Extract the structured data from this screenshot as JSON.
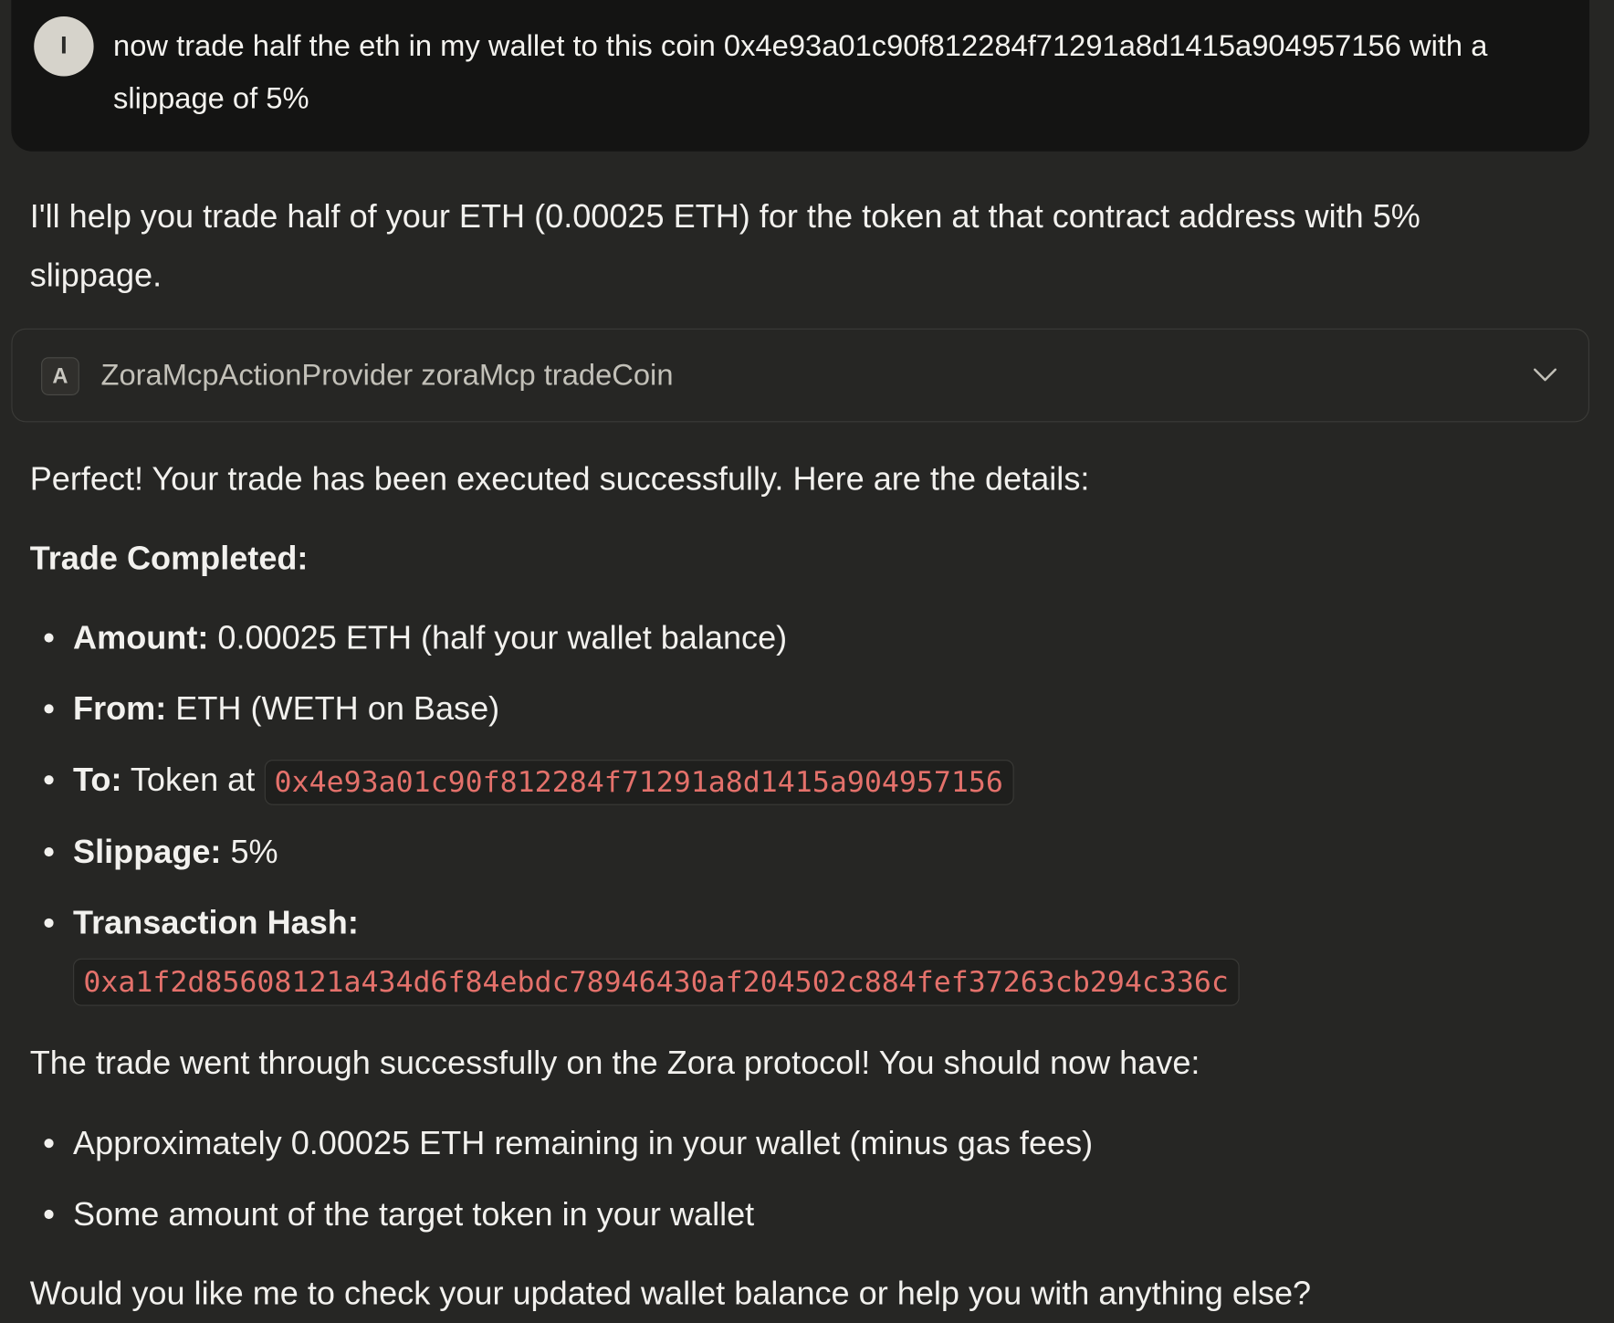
{
  "user_message": {
    "avatar_initial": "I",
    "text": "now trade half the eth in my wallet to this coin 0x4e93a01c90f812284f71291a8d1415a904957156 with a slippage of 5%"
  },
  "assistant": {
    "intro": "I'll help you trade half of your ETH (0.00025 ETH) for the token at that contract address with 5% slippage.",
    "tool_call": {
      "badge": "A",
      "label": "ZoraMcpActionProvider zoraMcp tradeCoin",
      "expand_icon": "chevron-down-icon"
    },
    "perfect": "Perfect! Your trade has been executed successfully. Here are the details:",
    "heading": "Trade Completed:",
    "details": {
      "amount_label": "Amount:",
      "amount_value": " 0.00025 ETH (half your wallet balance)",
      "from_label": "From:",
      "from_value": " ETH (WETH on Base)",
      "to_label": "To:",
      "to_value": " Token at ",
      "to_address": "0x4e93a01c90f812284f71291a8d1415a904957156",
      "slippage_label": "Slippage:",
      "slippage_value": " 5%",
      "hash_label": "Transaction Hash:",
      "hash_value": "0xa1f2d85608121a434d6f84ebdc78946430af204502c884fef37263cb294c336c"
    },
    "through": "The trade went through successfully on the Zora protocol! You should now have:",
    "outcomes": [
      "Approximately 0.00025 ETH remaining in your wallet (minus gas fees)",
      "Some amount of the target token in your wallet"
    ],
    "closing": "Would you like me to check your updated wallet balance or help you with anything else?"
  }
}
